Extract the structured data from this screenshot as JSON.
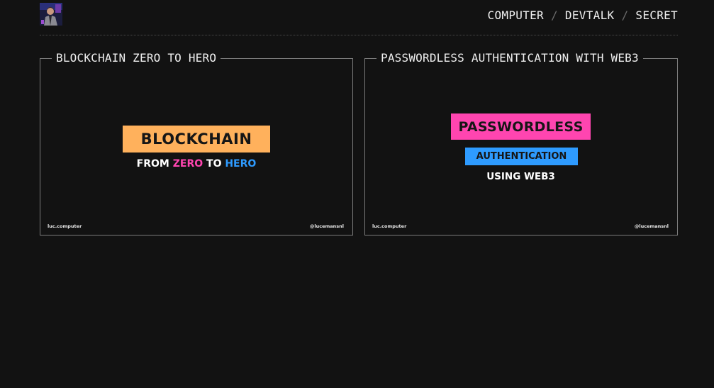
{
  "header": {
    "avatar_alt": "profile photo",
    "nav": [
      {
        "label": "COMPUTER"
      },
      {
        "label": "DEVTALK"
      },
      {
        "label": "SECRET"
      }
    ],
    "separator": "/"
  },
  "cards": [
    {
      "title": "BLOCKCHAIN ZERO TO HERO",
      "thumbnail": {
        "main_label": "BLOCKCHAIN",
        "sub_parts": [
          "FROM ",
          "ZERO",
          " TO ",
          "HERO"
        ],
        "footer_left": "luc.computer",
        "footer_right": "@lucemansnl"
      }
    },
    {
      "title": "PASSWORDLESS AUTHENTICATION WITH WEB3",
      "thumbnail": {
        "main_label": "PASSWORDLESS",
        "secondary_label": "AUTHENTICATION",
        "sub_label": "USING WEB3",
        "footer_left": "luc.computer",
        "footer_right": "@lucemansnl"
      }
    }
  ],
  "colors": {
    "background": "#121212",
    "orange": "#ffb15c",
    "pink": "#ff45b0",
    "blue": "#2e9bff",
    "border": "#7c7c7c"
  }
}
